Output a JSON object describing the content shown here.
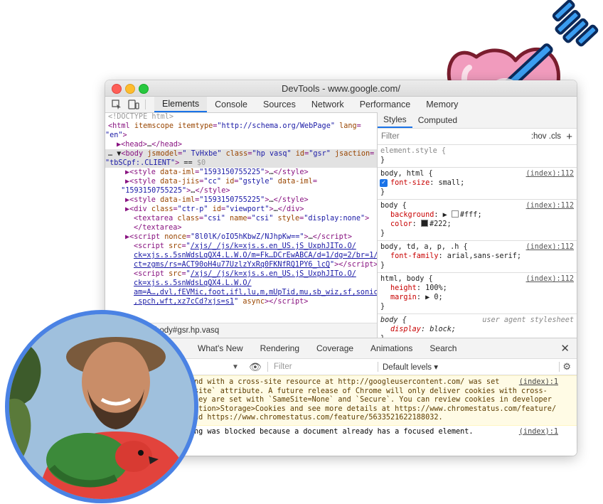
{
  "window": {
    "title": "DevTools - www.google.com/"
  },
  "toolbar": {
    "tabs": [
      "Elements",
      "Console",
      "Sources",
      "Network",
      "Performance",
      "Memory"
    ]
  },
  "elements": {
    "lines": [
      {
        "indent": 0,
        "html": "<span class='cmt'>&lt;!DOCTYPE html&gt;</span>"
      },
      {
        "indent": 0,
        "html": "<span class='tag'>&lt;html </span><span class='attr'>itemscope itemtype</span><span class='tag'>=</span><span class='val'>\"http://schema.org/WebPage\"</span> <span class='attr'>lang</span><span class='tag'>=</span>"
      },
      {
        "indent": -1,
        "html": "<span class='val'>\"en\"</span><span class='tag'>&gt;</span>"
      },
      {
        "indent": 1,
        "html": "▶<span class='tag'>&lt;head&gt;</span><span class='txt'>…</span><span class='tag'>&lt;/head&gt;</span>"
      },
      {
        "indent": 0,
        "sel": true,
        "html": "<span class='txt'>… ▼</span><span class='tag'>&lt;body </span><span class='attr'>jsmodel</span>=<span class='val'>\" TvHxbe\"</span> <span class='attr'>class</span>=<span class='val'>\"hp vasq\"</span> <span class='attr'>id</span>=<span class='val'>\"gsr\"</span> <span class='attr'>jsaction</span>="
      },
      {
        "indent": -1,
        "sel": true,
        "html": "<span class='val'>\"tbSCpf:.CLIENT\"</span><span class='tag'>&gt;</span> <span class='txt'>== </span><span class='cmt'>$0</span>"
      },
      {
        "indent": 2,
        "html": "▶<span class='tag'>&lt;style </span><span class='attr'>data-iml</span>=<span class='val'>\"1593150755225\"</span><span class='tag'>&gt;</span><span class='txt'>…</span><span class='tag'>&lt;/style&gt;</span>"
      },
      {
        "indent": 2,
        "html": "▶<span class='tag'>&lt;style </span><span class='attr'>data-jiis</span>=<span class='val'>\"cc\"</span> <span class='attr'>id</span>=<span class='val'>\"gstyle\"</span> <span class='attr'>data-iml</span>="
      },
      {
        "indent": 1,
        "html": " <span class='val'>\"1593150755225\"</span><span class='tag'>&gt;</span><span class='txt'>…</span><span class='tag'>&lt;/style&gt;</span>"
      },
      {
        "indent": 2,
        "html": "▶<span class='tag'>&lt;style </span><span class='attr'>data-iml</span>=<span class='val'>\"1593150755225\"</span><span class='tag'>&gt;</span><span class='txt'>…</span><span class='tag'>&lt;/style&gt;</span>"
      },
      {
        "indent": 2,
        "html": "▶<span class='tag'>&lt;div </span><span class='attr'>class</span>=<span class='val'>\"ctr-p\"</span> <span class='attr'>id</span>=<span class='val'>\"viewport\"</span><span class='tag'>&gt;</span><span class='txt'>…</span><span class='tag'>&lt;/div&gt;</span>"
      },
      {
        "indent": 3,
        "html": "<span class='tag'>&lt;textarea </span><span class='attr'>class</span>=<span class='val'>\"csi\"</span> <span class='attr'>name</span>=<span class='val'>\"csi\"</span> <span class='attr'>style</span>=<span class='val'>\"display:none\"</span><span class='tag'>&gt;</span>"
      },
      {
        "indent": 3,
        "html": "<span class='tag'>&lt;/textarea&gt;</span>"
      },
      {
        "indent": 2,
        "html": "▶<span class='tag'>&lt;script </span><span class='attr'>nonce</span>=<span class='val'>\"8l0lK/oIO5hKbwZ/NJhpKw==\"</span><span class='tag'>&gt;</span><span class='txt'>…</span><span class='tag'>&lt;/script&gt;</span>"
      },
      {
        "indent": 3,
        "html": "<span class='tag'>&lt;script </span><span class='attr'>src</span>=<span class='val'>\"</span><span class='link'>/xjs/_/js/k=xjs.s.en_US.jS_UxphJITo.O/</span>"
      },
      {
        "indent": 3,
        "html": "<span class='link'>ck=xjs.s.5snWdsLqQX4.L.W.O/m=Fk…DCrEwABCA/d=1/dg=2/br=1/</span>"
      },
      {
        "indent": 3,
        "html": "<span class='link'>ct=zgms/rs=ACT90oH4u77UzlzYxRq0FKNfRQ1PY6_lcQ</span><span class='val'>\"</span><span class='tag'>&gt;&lt;/script&gt;</span>"
      },
      {
        "indent": 3,
        "html": "<span class='tag'>&lt;script </span><span class='attr'>src</span>=<span class='val'>\"</span><span class='link'>/xjs/_/js/k=xjs.s.en_US.jS_UxphJITo.O/</span>"
      },
      {
        "indent": 3,
        "html": "<span class='link'>ck=xjs.s.5snWdsLqQX4.L.W.O/</span>"
      },
      {
        "indent": 3,
        "html": "<span class='link'>am=A…,dvl,fEVMic,foot,ifl,lu,m,mUpTid,mu,sb_wiz,sf,sonic</span>"
      },
      {
        "indent": 3,
        "html": "<span class='link'>,spch,wft,xz7cCd?xjs=s1</span><span class='val'>\"</span> <span class='attr'>async</span><span class='tag'>&gt;&lt;/script&gt;</span>"
      }
    ],
    "crumb": "body#gsr.hp.vasq"
  },
  "styles": {
    "tabs": [
      "Styles",
      "Computed"
    ],
    "filter_placeholder": "Filter",
    "cls": ":hov .cls",
    "element_style": "element.style {",
    "rules": [
      {
        "sel": "body, html {",
        "src": "(index):112",
        "props": [
          {
            "name": "font-size",
            "value": "small;",
            "checked": true
          }
        ]
      },
      {
        "sel": "body {",
        "src": "(index):112",
        "props": [
          {
            "name": "background",
            "value": "#fff;",
            "swatch": "#ffffff"
          },
          {
            "name": "color",
            "value": "#222;",
            "swatch": "#222222"
          }
        ]
      },
      {
        "sel": "body, td, a, p, .h {",
        "src": "(index):112",
        "props": [
          {
            "name": "font-family",
            "value": "arial,sans-serif;"
          }
        ]
      },
      {
        "sel": "html, body {",
        "src": "(index):112",
        "props": [
          {
            "name": "height",
            "value": "100%;"
          },
          {
            "name": "margin",
            "value": "▶ 0;"
          }
        ]
      },
      {
        "sel": "body {",
        "src": "user agent stylesheet",
        "italic": true,
        "props": [
          {
            "name": "display",
            "value": "block;"
          }
        ]
      }
    ]
  },
  "drawer": {
    "tabs": [
      "What's New",
      "Rendering",
      "Coverage",
      "Animations",
      "Search"
    ],
    "filter_placeholder": "Filter",
    "levels": "Default levels ▾",
    "messages": [
      {
        "type": "warn",
        "lines": [
          "nd with a cross-site resource at http://googleusercontent.com/ was set",
          "site` attribute. A future release of Chrome will only deliver cookies with cross-",
          "hey are set with `SameSite=None` and `Secure`. You can review cookies in developer",
          "ation>Storage>Cookies and see more details at https://www.chromestatus.com/feature/",
          "nd https://www.chromestatus.com/feature/5633521622188032."
        ],
        "src": "(index):1"
      },
      {
        "type": "info",
        "lines": [
          "ng was blocked because a document already has a focused element."
        ],
        "src": "(index):1"
      }
    ]
  },
  "colors": {
    "accent": "#1a73e8",
    "avatar_ring": "#4a82e4",
    "heart": "#f19bbd",
    "arrow": "#3b9df0"
  }
}
